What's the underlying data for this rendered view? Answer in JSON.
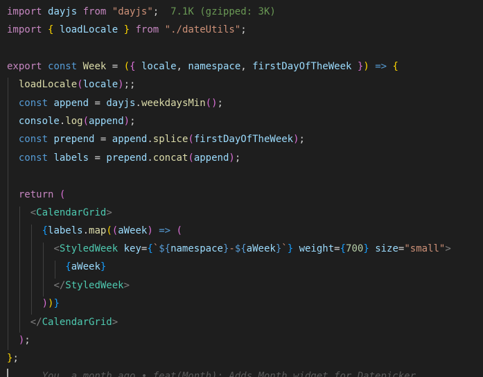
{
  "editor": {
    "bundle_size_hint": "7.1K (gzipped: 3K)",
    "git_blame": "You, a month ago • feat(Month): Adds Month widget for Datepicker",
    "tokens": {
      "import": "import",
      "from": "from",
      "export": "export",
      "const": "const",
      "return": "return",
      "dayjs": "dayjs",
      "dayjs_module": "\"dayjs\"",
      "loadLocale": "loadLocale",
      "dateUtils_module": "\"./dateUtils\"",
      "Week": "Week",
      "locale": "locale",
      "namespace": "namespace",
      "firstDayOfTheWeek": "firstDayOfTheWeek",
      "append": "append",
      "weekdaysMin": "weekdaysMin",
      "console": "console",
      "log": "log",
      "prepend": "prepend",
      "splice": "splice",
      "labels": "labels",
      "concat": "concat",
      "CalendarGrid": "CalendarGrid",
      "map": "map",
      "aWeek": "aWeek",
      "StyledWeek": "StyledWeek",
      "key": "key",
      "weight": "weight",
      "weight_value": "700",
      "size": "size",
      "size_value": "\"small\""
    }
  }
}
